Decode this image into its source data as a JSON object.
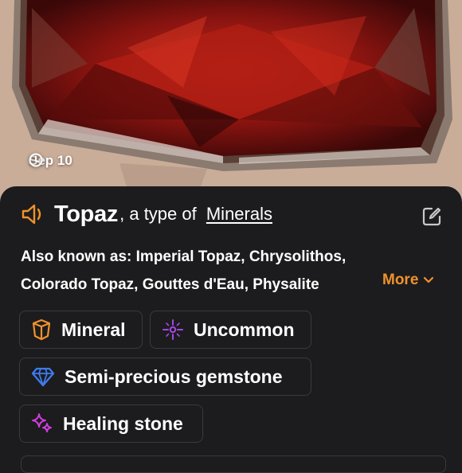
{
  "photo": {
    "date_label": "Sep 10",
    "date_icon": "clock-icon"
  },
  "identification": {
    "name": "Topaz",
    "separator": ", a type of ",
    "category": "Minerals",
    "speaker_icon": "speaker-icon",
    "edit_icon": "edit-icon"
  },
  "aka": {
    "label": "Also known as: ",
    "line1": "Imperial Topaz, Chrysolithos,",
    "line2": "Colorado Topaz, Gouttes d'Eau, Physalite",
    "more_label": "More"
  },
  "tags": [
    {
      "label": "Mineral",
      "icon": "crystal-icon",
      "color": "#f0922b"
    },
    {
      "label": "Uncommon",
      "icon": "sparkle-icon",
      "color": "#a448e0"
    },
    {
      "label": "Semi-precious gemstone",
      "icon": "diamond-icon",
      "color": "#3f7cf0"
    },
    {
      "label": "Healing stone",
      "icon": "stars-icon",
      "color": "#d23ee0"
    }
  ],
  "colors": {
    "accent": "#f0922b",
    "background": "#1c1c1e",
    "border": "#3a3a3c"
  }
}
